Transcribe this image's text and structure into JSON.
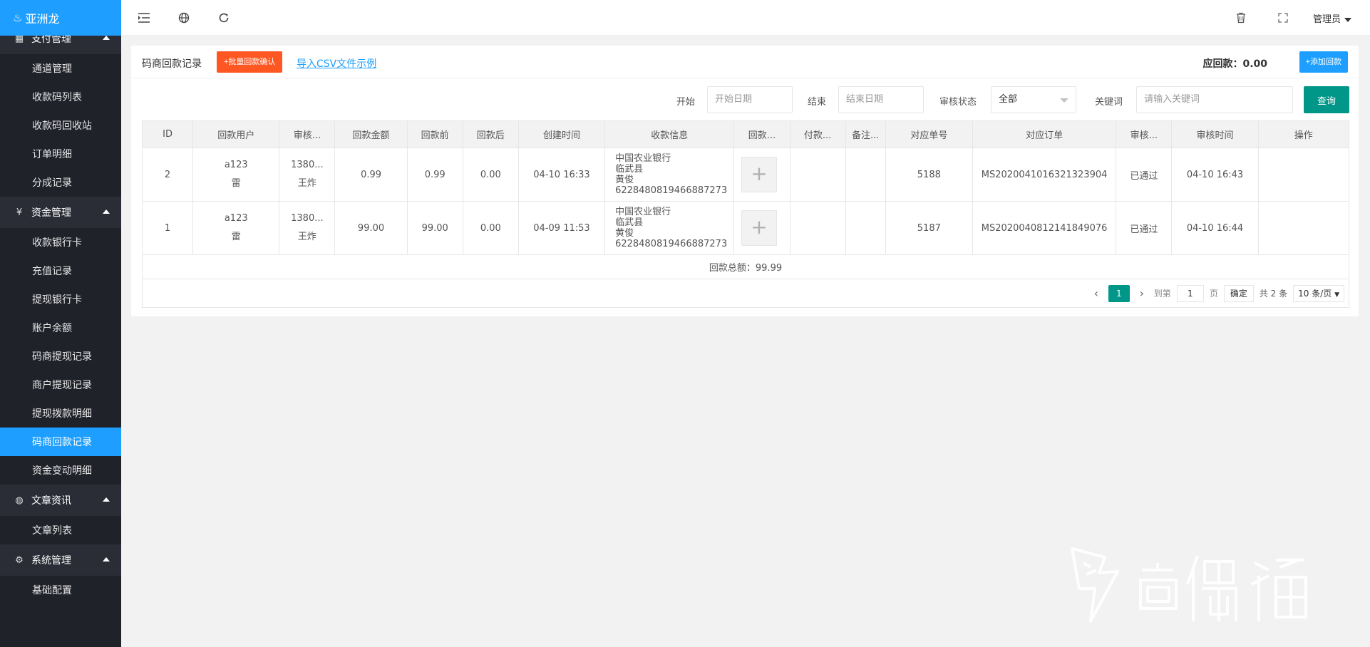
{
  "app": {
    "logo_icon": "flame-icon",
    "logo_text": "亚洲龙"
  },
  "sidebar": {
    "groups": [
      {
        "icon": "app-grid-icon",
        "label": "支付管理",
        "items": [
          "通道管理",
          "收款码列表",
          "收款码回收站",
          "订单明细",
          "分成记录"
        ]
      },
      {
        "icon": "yen-icon",
        "label": "资金管理",
        "items": [
          "收款银行卡",
          "充值记录",
          "提现银行卡",
          "账户余额",
          "码商提现记录",
          "商户提现记录",
          "提现拨款明细",
          "码商回款记录",
          "资金变动明细"
        ]
      },
      {
        "icon": "palette-icon",
        "label": "文章资讯",
        "items": [
          "文章列表"
        ]
      },
      {
        "icon": "gear-icon",
        "label": "系统管理",
        "items": [
          "基础配置"
        ]
      }
    ],
    "active_item": "码商回款记录"
  },
  "header": {
    "admin_label": "管理员"
  },
  "card": {
    "title": "码商回款记录",
    "batch_confirm_label": "+批量回款确认",
    "csv_link_label": "导入CSV文件示例",
    "due_label": "应回款：0.00",
    "add_payment_label": "+添加回款"
  },
  "filters": {
    "start_label": "开始",
    "start_placeholder": "开始日期",
    "end_label": "结束",
    "end_placeholder": "结束日期",
    "status_label": "审核状态",
    "status_value": "全部",
    "keyword_label": "关键词",
    "keyword_placeholder": "请输入关键词",
    "query_label": "查询"
  },
  "table": {
    "headers": [
      "ID",
      "回款用户",
      "审核...",
      "回款金额",
      "回款前",
      "回款后",
      "创建时间",
      "收款信息",
      "回款...",
      "付款...",
      "备注...",
      "对应单号",
      "对应订单",
      "审核...",
      "审核时间",
      "操作"
    ],
    "rows": [
      {
        "id": "2",
        "user": "a123",
        "user_name": "雷",
        "auditor": "1380...",
        "auditor_name": "王炸",
        "amount": "0.99",
        "before": "0.99",
        "after": "0.00",
        "created": "04-10 16:33",
        "bank": "中国农业银行",
        "city": "临武县",
        "holder": "黄俊",
        "card_no": "6228480819466887273",
        "voucher_icon": "plus-icon",
        "payer": "",
        "remark": "",
        "ref_no": "5188",
        "order_no": "MS2020041016321323904",
        "status": "已通过",
        "audit_time": "04-10 16:43",
        "ops": ""
      },
      {
        "id": "1",
        "user": "a123",
        "user_name": "雷",
        "auditor": "1380...",
        "auditor_name": "王炸",
        "amount": "99.00",
        "before": "99.00",
        "after": "0.00",
        "created": "04-09 11:53",
        "bank": "中国农业银行",
        "city": "临武县",
        "holder": "黄俊",
        "card_no": "6228480819466887273",
        "voucher_icon": "plus-icon",
        "payer": "",
        "remark": "",
        "ref_no": "5187",
        "order_no": "MS2020040812141849076",
        "status": "已通过",
        "audit_time": "04-10 16:44",
        "ops": ""
      }
    ],
    "total_label": "回款总额：99.99"
  },
  "pagination": {
    "current_page": "1",
    "goto_label": "到第",
    "goto_value": "1",
    "page_unit": "页",
    "confirm_label": "确定",
    "total_label": "共 2 条",
    "page_size_label": "10 条/页"
  }
}
